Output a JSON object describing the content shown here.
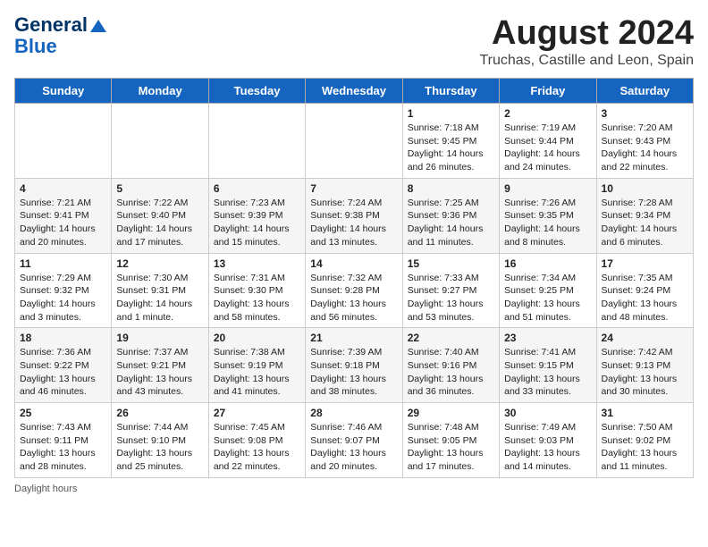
{
  "header": {
    "logo_line1": "General",
    "logo_line2": "Blue",
    "main_title": "August 2024",
    "subtitle": "Truchas, Castille and Leon, Spain"
  },
  "days_of_week": [
    "Sunday",
    "Monday",
    "Tuesday",
    "Wednesday",
    "Thursday",
    "Friday",
    "Saturday"
  ],
  "weeks": [
    [
      {
        "day": "",
        "sunrise": "",
        "sunset": "",
        "daylight": ""
      },
      {
        "day": "",
        "sunrise": "",
        "sunset": "",
        "daylight": ""
      },
      {
        "day": "",
        "sunrise": "",
        "sunset": "",
        "daylight": ""
      },
      {
        "day": "",
        "sunrise": "",
        "sunset": "",
        "daylight": ""
      },
      {
        "day": "1",
        "sunrise": "7:18 AM",
        "sunset": "9:45 PM",
        "daylight": "14 hours and 26 minutes."
      },
      {
        "day": "2",
        "sunrise": "7:19 AM",
        "sunset": "9:44 PM",
        "daylight": "14 hours and 24 minutes."
      },
      {
        "day": "3",
        "sunrise": "7:20 AM",
        "sunset": "9:43 PM",
        "daylight": "14 hours and 22 minutes."
      }
    ],
    [
      {
        "day": "4",
        "sunrise": "7:21 AM",
        "sunset": "9:41 PM",
        "daylight": "14 hours and 20 minutes."
      },
      {
        "day": "5",
        "sunrise": "7:22 AM",
        "sunset": "9:40 PM",
        "daylight": "14 hours and 17 minutes."
      },
      {
        "day": "6",
        "sunrise": "7:23 AM",
        "sunset": "9:39 PM",
        "daylight": "14 hours and 15 minutes."
      },
      {
        "day": "7",
        "sunrise": "7:24 AM",
        "sunset": "9:38 PM",
        "daylight": "14 hours and 13 minutes."
      },
      {
        "day": "8",
        "sunrise": "7:25 AM",
        "sunset": "9:36 PM",
        "daylight": "14 hours and 11 minutes."
      },
      {
        "day": "9",
        "sunrise": "7:26 AM",
        "sunset": "9:35 PM",
        "daylight": "14 hours and 8 minutes."
      },
      {
        "day": "10",
        "sunrise": "7:28 AM",
        "sunset": "9:34 PM",
        "daylight": "14 hours and 6 minutes."
      }
    ],
    [
      {
        "day": "11",
        "sunrise": "7:29 AM",
        "sunset": "9:32 PM",
        "daylight": "14 hours and 3 minutes."
      },
      {
        "day": "12",
        "sunrise": "7:30 AM",
        "sunset": "9:31 PM",
        "daylight": "14 hours and 1 minute."
      },
      {
        "day": "13",
        "sunrise": "7:31 AM",
        "sunset": "9:30 PM",
        "daylight": "13 hours and 58 minutes."
      },
      {
        "day": "14",
        "sunrise": "7:32 AM",
        "sunset": "9:28 PM",
        "daylight": "13 hours and 56 minutes."
      },
      {
        "day": "15",
        "sunrise": "7:33 AM",
        "sunset": "9:27 PM",
        "daylight": "13 hours and 53 minutes."
      },
      {
        "day": "16",
        "sunrise": "7:34 AM",
        "sunset": "9:25 PM",
        "daylight": "13 hours and 51 minutes."
      },
      {
        "day": "17",
        "sunrise": "7:35 AM",
        "sunset": "9:24 PM",
        "daylight": "13 hours and 48 minutes."
      }
    ],
    [
      {
        "day": "18",
        "sunrise": "7:36 AM",
        "sunset": "9:22 PM",
        "daylight": "13 hours and 46 minutes."
      },
      {
        "day": "19",
        "sunrise": "7:37 AM",
        "sunset": "9:21 PM",
        "daylight": "13 hours and 43 minutes."
      },
      {
        "day": "20",
        "sunrise": "7:38 AM",
        "sunset": "9:19 PM",
        "daylight": "13 hours and 41 minutes."
      },
      {
        "day": "21",
        "sunrise": "7:39 AM",
        "sunset": "9:18 PM",
        "daylight": "13 hours and 38 minutes."
      },
      {
        "day": "22",
        "sunrise": "7:40 AM",
        "sunset": "9:16 PM",
        "daylight": "13 hours and 36 minutes."
      },
      {
        "day": "23",
        "sunrise": "7:41 AM",
        "sunset": "9:15 PM",
        "daylight": "13 hours and 33 minutes."
      },
      {
        "day": "24",
        "sunrise": "7:42 AM",
        "sunset": "9:13 PM",
        "daylight": "13 hours and 30 minutes."
      }
    ],
    [
      {
        "day": "25",
        "sunrise": "7:43 AM",
        "sunset": "9:11 PM",
        "daylight": "13 hours and 28 minutes."
      },
      {
        "day": "26",
        "sunrise": "7:44 AM",
        "sunset": "9:10 PM",
        "daylight": "13 hours and 25 minutes."
      },
      {
        "day": "27",
        "sunrise": "7:45 AM",
        "sunset": "9:08 PM",
        "daylight": "13 hours and 22 minutes."
      },
      {
        "day": "28",
        "sunrise": "7:46 AM",
        "sunset": "9:07 PM",
        "daylight": "13 hours and 20 minutes."
      },
      {
        "day": "29",
        "sunrise": "7:48 AM",
        "sunset": "9:05 PM",
        "daylight": "13 hours and 17 minutes."
      },
      {
        "day": "30",
        "sunrise": "7:49 AM",
        "sunset": "9:03 PM",
        "daylight": "13 hours and 14 minutes."
      },
      {
        "day": "31",
        "sunrise": "7:50 AM",
        "sunset": "9:02 PM",
        "daylight": "13 hours and 11 minutes."
      }
    ]
  ],
  "footer": {
    "note": "Daylight hours"
  }
}
